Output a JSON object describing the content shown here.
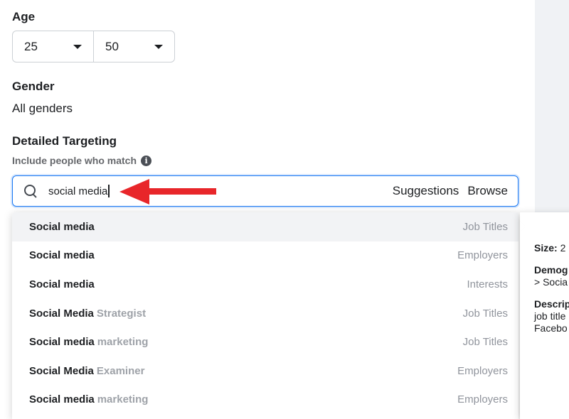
{
  "age": {
    "label": "Age",
    "min": "25",
    "max": "50"
  },
  "gender": {
    "label": "Gender",
    "value": "All genders"
  },
  "detailed_targeting": {
    "label": "Detailed Targeting",
    "include_label": "Include people who match",
    "search_value": "social media",
    "suggestions_label": "Suggestions",
    "browse_label": "Browse"
  },
  "results": [
    {
      "match": "Social media",
      "rest": "",
      "category": "Job Titles"
    },
    {
      "match": "Social media",
      "rest": "",
      "category": "Employers"
    },
    {
      "match": "Social media",
      "rest": "",
      "category": "Interests"
    },
    {
      "match": "Social Media",
      "rest": "Strategist",
      "category": "Job Titles"
    },
    {
      "match": "Social media",
      "rest": "marketing",
      "category": "Job Titles"
    },
    {
      "match": "Social Media",
      "rest": "Examiner",
      "category": "Employers"
    },
    {
      "match": "Social media",
      "rest": "marketing",
      "category": "Employers"
    }
  ],
  "detail_card": {
    "size_label": "Size:",
    "size_value": "2",
    "demog_label": "Demog",
    "demog_value": "> Socia",
    "descr_label": "Descrip",
    "descr_line1": "job title",
    "descr_line2": "Facebo"
  },
  "colors": {
    "accent": "#1877f2",
    "arrow": "#e8262a",
    "muted": "#90949c"
  }
}
